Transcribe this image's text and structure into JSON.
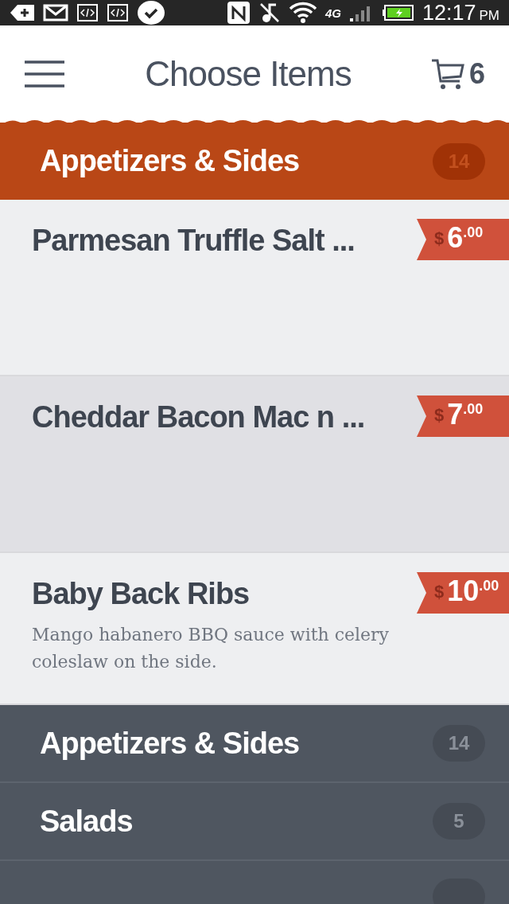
{
  "status_bar": {
    "time": "12:17",
    "ampm": "PM",
    "network": "4G"
  },
  "header": {
    "title": "Choose Items",
    "cart_count": "6"
  },
  "current_category": {
    "name": "Appetizers & Sides",
    "count": "14"
  },
  "items": [
    {
      "name": "Parmesan Truffle Salt ...",
      "currency": "$",
      "price_whole": "6",
      "price_cents": ".00",
      "selected": false
    },
    {
      "name": "Cheddar Bacon Mac n ...",
      "currency": "$",
      "price_whole": "7",
      "price_cents": ".00",
      "selected": true
    },
    {
      "name": "Baby Back Ribs",
      "description": "Mango habanero BBQ sauce with celery coleslaw on the side.",
      "currency": "$",
      "price_whole": "10",
      "price_cents": ".00",
      "selected": false
    }
  ],
  "categories": [
    {
      "name": "Appetizers & Sides",
      "count": "14"
    },
    {
      "name": "Salads",
      "count": "5"
    }
  ]
}
